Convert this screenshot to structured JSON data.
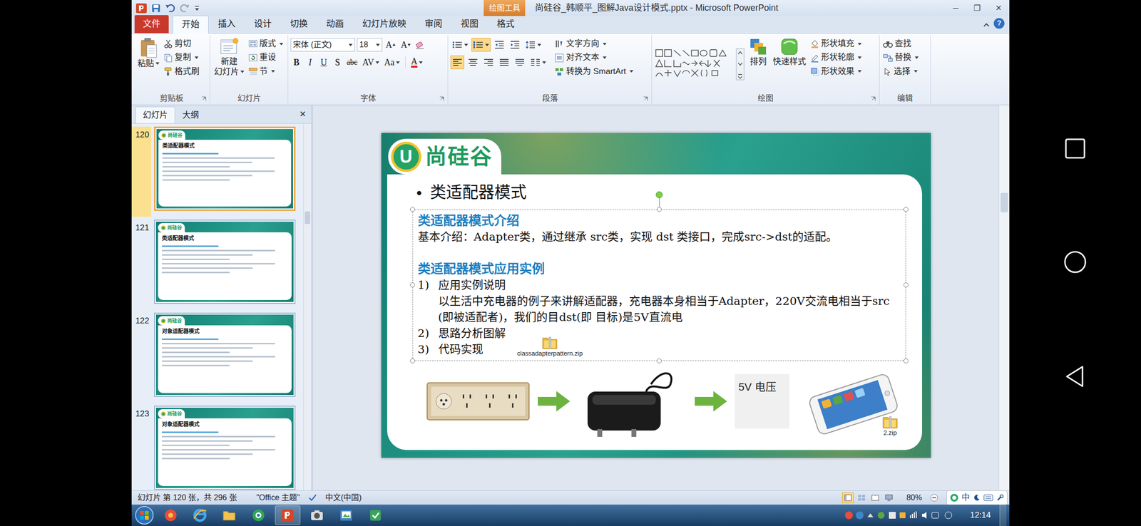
{
  "window": {
    "title": "尚硅谷_韩顺平_图解Java设计模式.pptx - Microsoft PowerPoint",
    "context_tab_group": "绘图工具",
    "controls": [
      "─",
      "❐",
      "✕"
    ]
  },
  "ribbon_tabs": [
    {
      "label": "文件",
      "selected": false,
      "kind": "file"
    },
    {
      "label": "开始",
      "selected": true,
      "kind": "tab"
    },
    {
      "label": "插入",
      "selected": false,
      "kind": "tab"
    },
    {
      "label": "设计",
      "selected": false,
      "kind": "tab"
    },
    {
      "label": "切换",
      "selected": false,
      "kind": "tab"
    },
    {
      "label": "动画",
      "selected": false,
      "kind": "tab"
    },
    {
      "label": "幻灯片放映",
      "selected": false,
      "kind": "tab"
    },
    {
      "label": "审阅",
      "selected": false,
      "kind": "tab"
    },
    {
      "label": "视图",
      "selected": false,
      "kind": "tab"
    },
    {
      "label": "格式",
      "selected": false,
      "kind": "context"
    }
  ],
  "ribbon_help": "?",
  "ribbon": {
    "groups": [
      "剪贴板",
      "幻灯片",
      "字体",
      "段落",
      "绘图",
      "编辑"
    ],
    "paste": "粘贴",
    "clipboard_items": [
      "剪切",
      "复制",
      "格式刷"
    ],
    "new_slide": [
      "新建",
      "幻灯片"
    ],
    "slide_items": [
      "版式",
      "重设",
      "节"
    ],
    "font_name": "宋体 (正文)",
    "font_size": "18",
    "size_buttons": [
      "A",
      "A"
    ],
    "format_buttons": [
      "B",
      "I",
      "U",
      "S",
      "abc",
      "AV",
      "Aa",
      "A"
    ],
    "paragraph_toggles": [
      {
        "kind": "bullets",
        "selected": false
      },
      {
        "kind": "numbering",
        "selected": true
      },
      {
        "kind": "indent_dec",
        "selected": false
      },
      {
        "kind": "indent_inc",
        "selected": false
      },
      {
        "kind": "line_spacing",
        "selected": false
      },
      {
        "kind": "align_left",
        "selected": true
      },
      {
        "kind": "align_center",
        "selected": false
      },
      {
        "kind": "align_right",
        "selected": false
      },
      {
        "kind": "justify",
        "selected": false
      },
      {
        "kind": "distribute",
        "selected": false
      },
      {
        "kind": "columns",
        "selected": false
      }
    ],
    "paragraph_items": [
      "文字方向",
      "对齐文本",
      "转换为 SmartArt"
    ],
    "arrange": "排列",
    "quick_styles": "快速样式",
    "shape_items": [
      "形状填充",
      "形状轮廓",
      "形状效果"
    ],
    "editing_items": [
      "查找",
      "替换",
      "选择"
    ]
  },
  "panel": {
    "tabs": [
      {
        "label": "幻灯片",
        "selected": true
      },
      {
        "label": "大纲",
        "selected": false
      }
    ],
    "close": "✕",
    "thumbnails": [
      {
        "number": "120",
        "logo": "尚硅谷",
        "title": "类适配器模式",
        "selected": true
      },
      {
        "number": "121",
        "logo": "尚硅谷",
        "title": "类适配器模式",
        "selected": false
      },
      {
        "number": "122",
        "logo": "尚硅谷",
        "title": "对象适配器模式",
        "selected": false
      },
      {
        "number": "123",
        "logo": "尚硅谷",
        "title": "对象适配器模式",
        "selected": false
      }
    ]
  },
  "slide": {
    "logo_mark": "U",
    "logo": "尚硅谷",
    "bullet": "●",
    "title": "类适配器模式",
    "textbox_selected": true,
    "body": [
      {
        "kind": "heading",
        "text": "类适配器模式介绍"
      },
      {
        "kind": "text",
        "text": "基本介绍：Adapter类，通过继承 src类，实现 dst 类接口，完成src->dst的适配。"
      },
      {
        "kind": "heading",
        "text": "类适配器模式应用实例"
      },
      {
        "kind": "item",
        "num": "1)",
        "text": "应用实例说明"
      },
      {
        "kind": "indent",
        "text": "以生活中充电器的例子来讲解适配器，充电器本身相当于Adapter，220V交流电相当于src (即被适配者)，我们的目dst(即 目标)是5V直流电"
      },
      {
        "kind": "item",
        "num": "2)",
        "text": "思路分析图解"
      },
      {
        "kind": "attached",
        "num": "3)",
        "text": "代码实现",
        "attachment": "classadapterpattern.zip"
      }
    ],
    "voltage_label": "5V 电压",
    "phone_attachment": "2.zip"
  },
  "status": {
    "slide_info": "幻灯片 第 120 张，共 296 张",
    "theme": "\"Office 主题\"",
    "language": "中文(中国)",
    "views": [
      {
        "kind": "normal",
        "selected": true
      },
      {
        "kind": "sorter",
        "selected": false
      },
      {
        "kind": "reading",
        "selected": false
      },
      {
        "kind": "slideshow",
        "selected": false
      }
    ],
    "zoom": "80%",
    "ime": "中"
  },
  "taskbar": {
    "apps": [
      {
        "kind": "media",
        "selected": false
      },
      {
        "kind": "ie",
        "selected": false
      },
      {
        "kind": "folder",
        "selected": false
      },
      {
        "kind": "browser",
        "selected": false
      },
      {
        "kind": "powerpoint",
        "selected": true
      },
      {
        "kind": "camera",
        "selected": false
      },
      {
        "kind": "paint",
        "selected": false
      },
      {
        "kind": "tool",
        "selected": false
      }
    ],
    "time": "12:14"
  }
}
